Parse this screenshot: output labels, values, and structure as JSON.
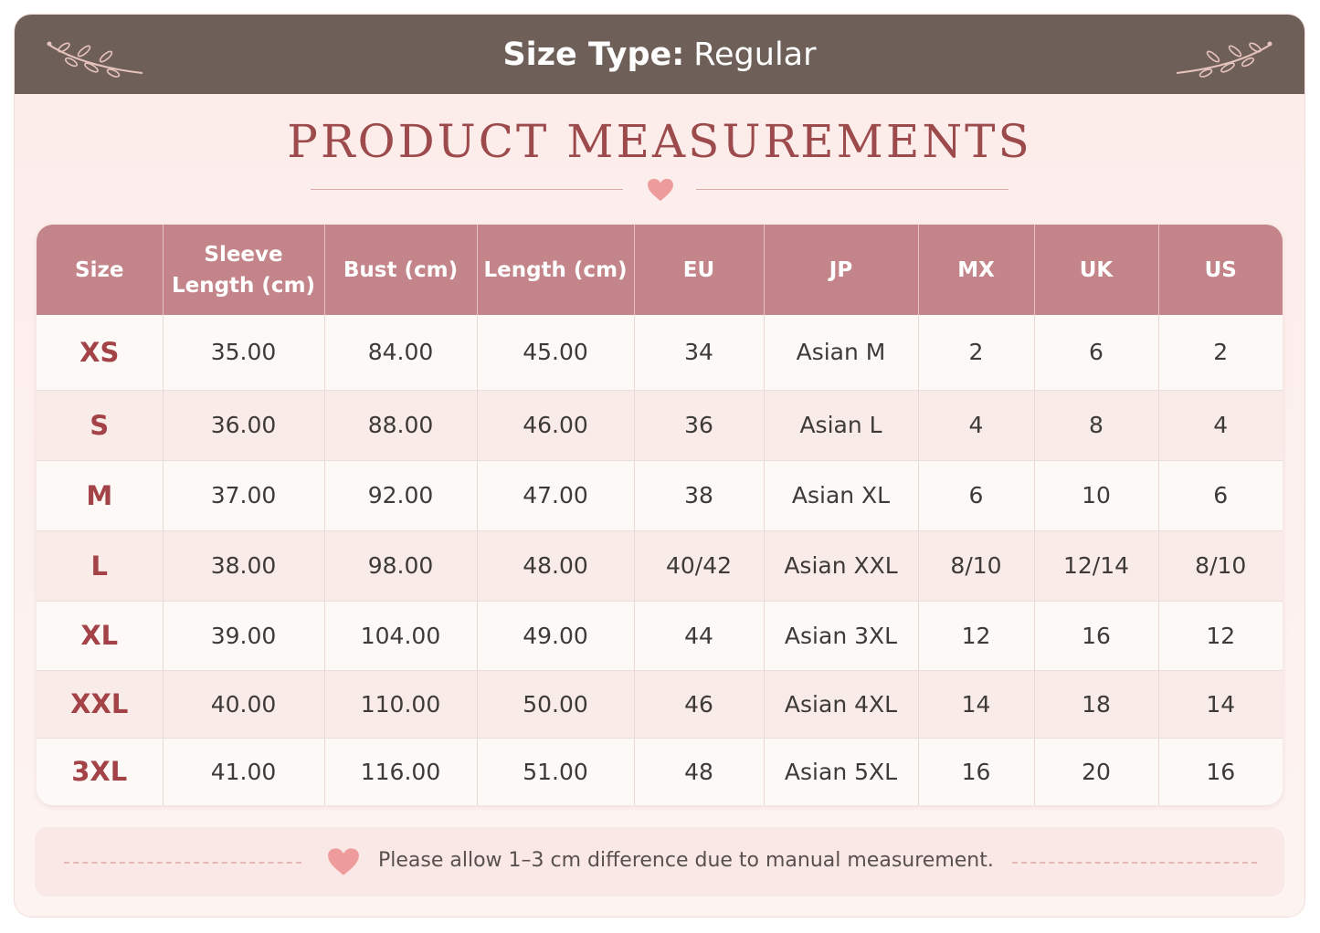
{
  "banner": {
    "label": "Size Type:",
    "value": "Regular"
  },
  "title": "PRODUCT MEASUREMENTS",
  "table": {
    "headers": [
      "Size",
      "Sleeve Length (cm)",
      "Bust (cm)",
      "Length (cm)",
      "EU",
      "JP",
      "MX",
      "UK",
      "US"
    ],
    "rows": [
      [
        "XS",
        "35.00",
        "84.00",
        "45.00",
        "34",
        "Asian M",
        "2",
        "6",
        "2"
      ],
      [
        "S",
        "36.00",
        "88.00",
        "46.00",
        "36",
        "Asian L",
        "4",
        "8",
        "4"
      ],
      [
        "M",
        "37.00",
        "92.00",
        "47.00",
        "38",
        "Asian XL",
        "6",
        "10",
        "6"
      ],
      [
        "L",
        "38.00",
        "98.00",
        "48.00",
        "40/42",
        "Asian XXL",
        "8/10",
        "12/14",
        "8/10"
      ],
      [
        "XL",
        "39.00",
        "104.00",
        "49.00",
        "44",
        "Asian 3XL",
        "12",
        "16",
        "12"
      ],
      [
        "XXL",
        "40.00",
        "110.00",
        "50.00",
        "46",
        "Asian 4XL",
        "14",
        "18",
        "14"
      ],
      [
        "3XL",
        "41.00",
        "116.00",
        "51.00",
        "48",
        "Asian 5XL",
        "16",
        "20",
        "16"
      ]
    ]
  },
  "note": "Please allow 1–3 cm difference due to manual measurement.",
  "colors": {
    "banner": "#6e6058",
    "header": "#c4858a",
    "accent": "#a34247",
    "heart": "#ee9b9b"
  },
  "icons": [
    "sprig-icon",
    "heart-icon"
  ]
}
